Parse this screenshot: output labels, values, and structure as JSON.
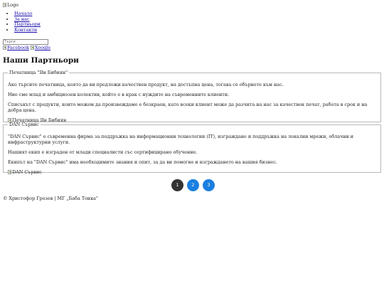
{
  "header": {
    "logo_alt": "Logo",
    "nav": [
      "Начало",
      "За нас",
      "Партньори",
      "Контакти"
    ],
    "search_placeholder": "Търси",
    "social": [
      "Facebook",
      "Xoogle"
    ]
  },
  "main": {
    "title": "Наши Партньори",
    "partners": [
      {
        "name": "Печатница \"Ян Бибиян\"",
        "paragraphs": [
          "Ако търсите печатница, която да ви предложи качествен продукт, на достъпна цена, тогава се обърнете към нас.",
          "Ние сме млад и амбициозен колектив, който е в крак с нуждите на съвременните клиенти.",
          "Списъкът с продукти, които можем да произвеждаме е безкраен, като всеки клиент може да разчита на нас за качествен печат, работа в срок и на добра цена."
        ],
        "image_alt": "Печатница Ян Бибиян"
      },
      {
        "name": "DAN Сървис",
        "paragraphs": [
          "\"DAN Сървис\" е съвременна фирма за поддръжка на информационни технологии (IT), изграждане и поддръжка на локални мрежи, облачни и инфраструктурни услуги.",
          "Нашият екип е изграден от млади специалисти със сертифицирано обучение.",
          "Екипът на \"DAN Сървис\" има необходимите знания и опит, за да ви помогне и изграждането на вашия бизнес."
        ],
        "image_alt": "DAN Сървис"
      }
    ],
    "pagination": {
      "pages": [
        "1",
        "2",
        "3"
      ],
      "active": "1",
      "colors": {
        "active": "#333333",
        "inactive": "#1a7fe0"
      }
    }
  },
  "footer": {
    "text": "© Христофор Грозев | МГ „Баба Тонка\""
  }
}
